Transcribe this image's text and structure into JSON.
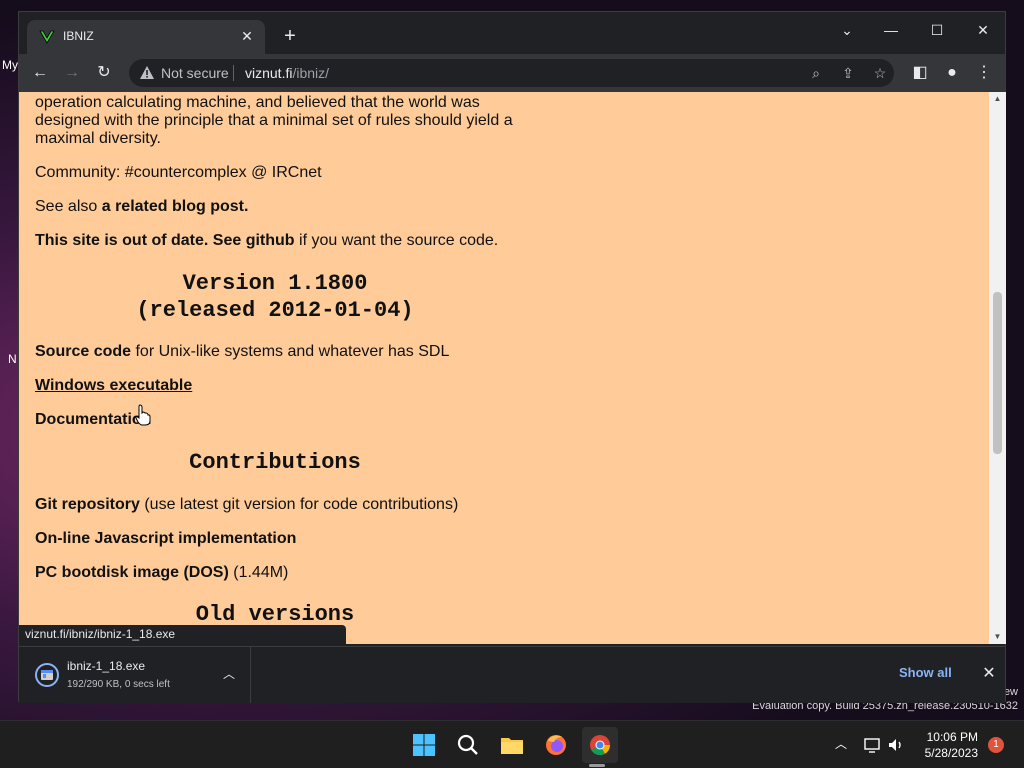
{
  "desktop": {
    "icon_label_1": "My",
    "icon_label_2": "N",
    "watermark": "Evaluation copy. Build 25375.zn_release.230510-1632",
    "watermark_tail": "ew"
  },
  "browser": {
    "tab_title": "IBNIZ",
    "security_label": "Not secure",
    "url_host": "viznut.fi",
    "url_path": "/ibniz/",
    "status_url": "viznut.fi/ibniz/ibniz-1_18.exe"
  },
  "page": {
    "intro_line1": "operation calculating machine, and believed that the world was",
    "intro_line2": "designed with the principle that a minimal set of rules should yield a",
    "intro_line3": "maximal diversity.",
    "community": "Community: #countercomplex @ IRCnet",
    "see_also_prefix": "See also ",
    "see_also_link": "a related blog post.",
    "outdated_bold": "This site is out of date. See github",
    "outdated_rest": " if you want the source code.",
    "version_heading": "Version 1.1800\n(released 2012-01-04)",
    "source_code_bold": "Source code",
    "source_code_rest": " for Unix-like systems and whatever has SDL",
    "windows_exe": "Windows executable",
    "documentation": "Documentation",
    "contributions_heading": "Contributions",
    "git_bold": "Git repository",
    "git_rest": " (use latest git version for code contributions)",
    "js_impl": "On-line Javascript implementation",
    "bootdisk_bold": "PC bootdisk image (DOS)",
    "bootdisk_rest": " (1.44M)",
    "old_versions_heading": "Old versions"
  },
  "downloads": {
    "file_name": "ibniz-1_18.exe",
    "progress": "192/290 KB, 0 secs left",
    "show_all": "Show all"
  },
  "taskbar": {
    "time": "10:06 PM",
    "date": "5/28/2023",
    "notification_count": "1"
  },
  "colors": {
    "page_background": "#ffcc99",
    "link_blue": "#8ab4f8",
    "chrome_dark": "#202124"
  }
}
